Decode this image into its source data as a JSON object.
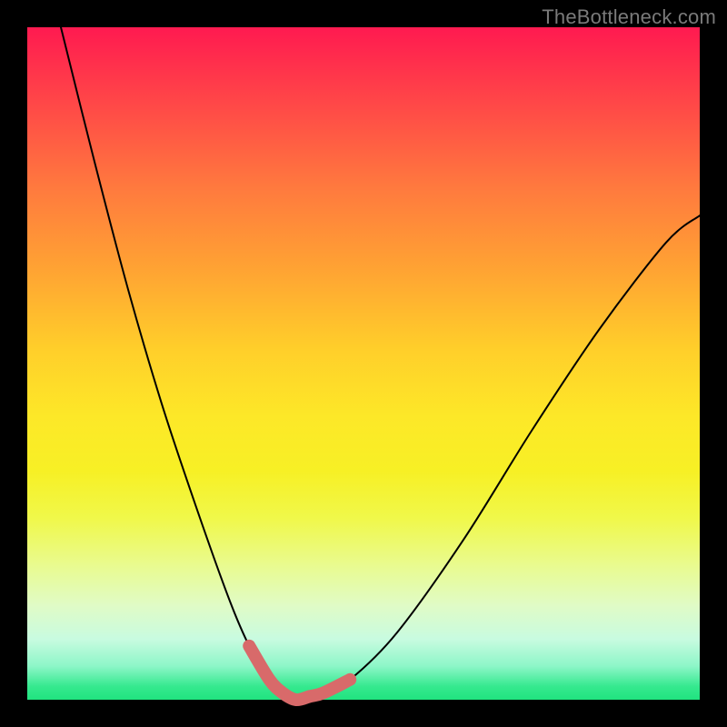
{
  "attribution": "TheBottleneck.com",
  "colors": {
    "page_bg": "#000000",
    "attribution_text": "#7a7a7a",
    "curve_stroke": "#000000",
    "highlight_stroke": "#d86a6a"
  },
  "chart_data": {
    "type": "line",
    "title": "",
    "xlabel": "",
    "ylabel": "",
    "xlim": [
      0,
      100
    ],
    "ylim": [
      0,
      100
    ],
    "grid": false,
    "legend": false,
    "annotations": [],
    "series": [
      {
        "name": "bottleneck-curve",
        "x": [
          5,
          10,
          15,
          20,
          25,
          30,
          33,
          36,
          38,
          40,
          42,
          44,
          48,
          55,
          65,
          75,
          85,
          95,
          100
        ],
        "values": [
          100,
          80,
          61,
          44,
          29,
          15,
          8,
          3,
          1,
          0,
          0.5,
          1,
          3,
          10,
          24,
          40,
          55,
          68,
          72
        ]
      },
      {
        "name": "min-highlight",
        "x": [
          33,
          36,
          38,
          40,
          42,
          44,
          48
        ],
        "values": [
          8,
          3,
          1,
          0,
          0.5,
          1,
          3
        ]
      }
    ]
  }
}
